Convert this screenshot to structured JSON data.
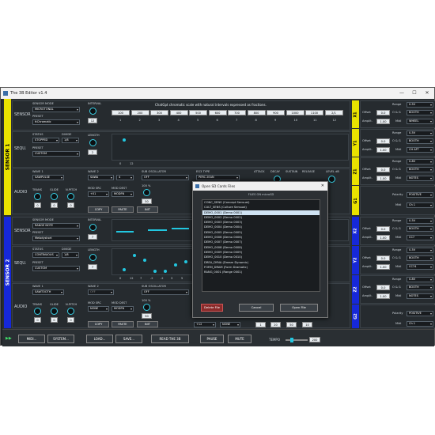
{
  "window": {
    "title": "The 3B Editor v1.4",
    "min": "—",
    "max": "☐",
    "close": "✕"
  },
  "sensor1": {
    "label": "SENSOR 1",
    "sensor_mode_label": "SENSOR MODE",
    "sensor_mode": "MICROTONAL",
    "preset_label": "PRESET",
    "preset": "ttChromatic",
    "interval_label": "INTERVAL",
    "interval_value": "12",
    "scale_desc": "ChatGpt chromatic scale with natural intervals expressed as fractions.",
    "intervals": [
      "100",
      "200",
      "300",
      "400",
      "500",
      "600",
      "700",
      "800",
      "900",
      "1000",
      "1100",
      "2/1"
    ],
    "interval_idx": [
      "1",
      "2",
      "3",
      "4",
      "5",
      "6",
      "7",
      "8",
      "9",
      "10",
      "11",
      "12"
    ],
    "status_label": "STATUS",
    "status": "STOPPED",
    "divide_label": "DIVIDE",
    "divide": "1/8",
    "seq_preset_label": "PRESET",
    "seq_preset": "CUSTOM",
    "length_label": "LENGTH",
    "length_value": "2",
    "seq_ticks": [
      "0",
      "12"
    ],
    "wave1_label": "WAVE 1",
    "wave1": "SAWPULSE",
    "wave2_label": "WAVE 2",
    "wave2": "SAWA",
    "wave2_num": "4",
    "sub_label": "SUB OSCILLATOR",
    "sub": "OFF",
    "eg_label": "EG3 TYPE",
    "eg": "PERC 2EAN",
    "attack_label": "ATTACK",
    "decay_label": "DECAY",
    "sustain_label": "SUSTAIN",
    "release_label": "RELEASE",
    "level_label": "LEVEL dB",
    "trans_label": "TRANS",
    "glide_label": "GLIDE",
    "npitch_label": "N.PITCH",
    "trans": "0",
    "glide": "0",
    "npitch": "0",
    "mod_src_label": "MOD SRC",
    "mod_src": "+01",
    "mod_dest_label": "MOD DEST",
    "mod_dest": "MODFN",
    "pct": "100 %",
    "mod_amt": "50",
    "copy": "COPY",
    "paste": "PASTE",
    "init": "INIT",
    "freq_label": "FREQ",
    "reso_label": "RESO",
    "env_label": "ENV"
  },
  "sensor2": {
    "label": "SENSOR 2",
    "sensor_mode_label": "SENSOR MODE",
    "sensor_mode": "RANGE NOTE",
    "preset_label": "PRESET",
    "preset": "Melodyshort",
    "interval_label": "INTERVAL",
    "interval_value": "7",
    "status_label": "STATUS",
    "status": "CONTINUOUS",
    "divide_label": "DIVIDE",
    "divide": "1/8",
    "seq_preset_label": "PRESET",
    "seq_preset": "CUSTOM",
    "length_label": "LENGTH",
    "length_value": "7",
    "seq_ticks": [
      "0",
      "12",
      "7",
      "-2",
      "-2",
      "3",
      "5"
    ],
    "wave1_label": "WAVE 1",
    "wave1": "SAWTOOTH",
    "wave2_label": "WAVE 2",
    "wave2": "OFF",
    "sub_label": "SUB OSCILLATOR",
    "sub": "OFF",
    "trans_label": "TRANS",
    "glide_label": "GLIDE",
    "npitch_label": "N.PITCH",
    "trans": "0",
    "glide": "0",
    "npitch": "0",
    "mod_src_label": "MOD SRC",
    "mod_src": "NONE",
    "mod_dest_label": "MOD DEST",
    "mod_dest": "MODFN",
    "pct": "100 %",
    "mod_amt": "50",
    "copy": "COPY",
    "paste": "PASTE",
    "init": "INIT",
    "extra_sel1": "+12",
    "extra_sel2": "NONE",
    "extra_vals": [
      "1",
      "20",
      "50",
      "10"
    ]
  },
  "section_labels": {
    "sensor": "SENSOR",
    "sequ": "SEQU.",
    "audio": "AUDIO"
  },
  "outputs": [
    {
      "tag": "X1",
      "range_label": "Range",
      "range": "0-5V",
      "offset_label": "Offset",
      "offset": "0.0",
      "mode_label": "O & G",
      "mode": "BOOTH",
      "ampl_label": "Amplit.",
      "ampl": "1.00",
      "midi_label": "Midi",
      "midi": "WHEEL"
    },
    {
      "tag": "Y1",
      "range_label": "Range",
      "range": "0-5V",
      "offset_label": "Offset",
      "offset": "0.0",
      "mode_label": "O & G",
      "mode": "BOOTH",
      "ampl_label": "Amplit.",
      "ampl": "1.00",
      "midi_label": "Midi",
      "midi": "CH AFT"
    },
    {
      "tag": "Z1",
      "range_label": "Range",
      "range": "0-8V",
      "offset_label": "Offset",
      "offset": "0.0",
      "mode_label": "O & G",
      "mode": "BOOTH",
      "ampl_label": "Amplit.",
      "ampl": "1.00",
      "midi_label": "Midi",
      "midi": "NOTES"
    },
    {
      "tag": "G1",
      "polarity_label": "Polarity",
      "polarity": "POSITIVE",
      "midi_label": "Midi",
      "midi": "Ch 1"
    },
    {
      "tag": "X2",
      "range_label": "Range",
      "range": "0-5V",
      "offset_label": "Offset",
      "offset": "0.0",
      "mode_label": "O & G",
      "mode": "BOOTH",
      "ampl_label": "Amplit.",
      "ampl": "1.00",
      "midi_label": "Midi",
      "midi": "CC7"
    },
    {
      "tag": "Y2",
      "range_label": "Range",
      "range": "0-5V",
      "offset_label": "Offset",
      "offset": "0.0",
      "mode_label": "O & G",
      "mode": "BOOTH",
      "ampl_label": "Amplit.",
      "ampl": "1.00",
      "midi_label": "Midi",
      "midi": "CC74"
    },
    {
      "tag": "Z2",
      "range_label": "Range",
      "range": "0-8V",
      "offset_label": "Offset",
      "offset": "0.0",
      "mode_label": "O & G",
      "mode": "BOOTH",
      "ampl_label": "Amplit.",
      "ampl": "1.00",
      "midi_label": "Midi",
      "midi": "NOTES"
    },
    {
      "tag": "G2",
      "polarity_label": "Polarity",
      "polarity": "POSITIVE",
      "midi_label": "Midi",
      "midi": "Ch 1"
    }
  ],
  "bottom": {
    "midi": "MIDI...",
    "system": "SYSTEM...",
    "load": "LOAD...",
    "save": "SAVE...",
    "read": "READ THE 3B",
    "pause": "PAUSE",
    "mute": "MUTE",
    "tempo_label": "TEMPO",
    "tempo": "200"
  },
  "dialog": {
    "title": "Open SD Cards Files",
    "close": "✕",
    "list_label": "FILES ON microSD",
    "files": [
      "CONC_SENS (Concept Sensual)",
      "CULT_SENS (Culture Sensual)",
      "DEMO_0001 (Demo 0001)",
      "DEMO_0002 (Demo 0002)",
      "DEMO_0003 (Demo 0003)",
      "DEMO_0004 (Demo 0004)",
      "DEMO_0005 (Demo 0005)",
      "DEMO_0006 (Demo 0006)",
      "DEMO_0007 (Demo 0007)",
      "DEMO_0008 (Demo 0008)",
      "DEMO_0009 (Demo 0009)",
      "DEMO_0010 (Demo 0010)",
      "DREA_DYNA (Dream Dynamic)",
      "FORM_DRAM (Form Dramatic)",
      "RANG_0001 (Range 0001)"
    ],
    "selected_index": 2,
    "delete": "Delete File",
    "cancel": "Cancel",
    "open": "Open File"
  }
}
